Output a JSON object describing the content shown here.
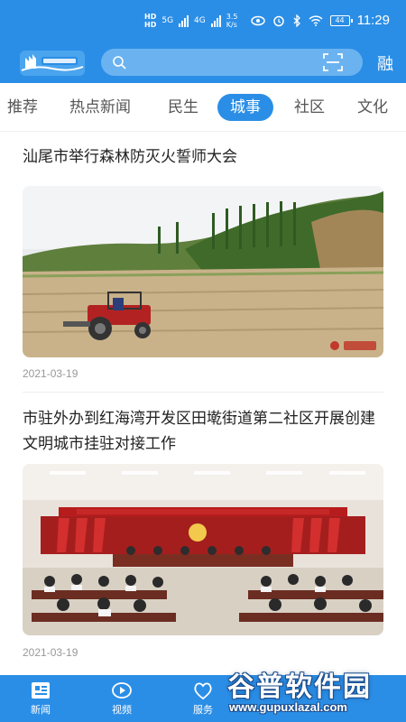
{
  "status_bar": {
    "hd1": "HD",
    "hd2": "HD",
    "net1": "5G",
    "net2": "4G",
    "speed_value": "3.5",
    "speed_unit": "K/s",
    "battery": "44",
    "time": "11:29"
  },
  "header": {
    "search_placeholder": "",
    "right_label": "融",
    "accent_color": "#2b8ee6"
  },
  "tabs": [
    {
      "label": "推荐"
    },
    {
      "label": "热点新闻"
    },
    {
      "label": "民生"
    },
    {
      "label": "城事",
      "active": true
    },
    {
      "label": "社区"
    },
    {
      "label": "文化"
    }
  ],
  "articles": [
    {
      "title": "汕尾市举行森林防灭火誓师大会",
      "image_desc": "tractor-field-photo",
      "date": "2021-03-19"
    },
    {
      "title": "市驻外办到红海湾开发区田墘街道第二社区开展创建文明城市挂驻对接工作",
      "image_desc": "meeting-hall-photo",
      "date": "2021-03-19"
    }
  ],
  "bottom_nav": [
    {
      "label": "新闻",
      "icon": "news-icon"
    },
    {
      "label": "视频",
      "icon": "video-icon"
    },
    {
      "label": "服务",
      "icon": "service-icon"
    }
  ],
  "watermark": {
    "text": "谷普软件园",
    "url": "www.gupuxlazal.com"
  }
}
